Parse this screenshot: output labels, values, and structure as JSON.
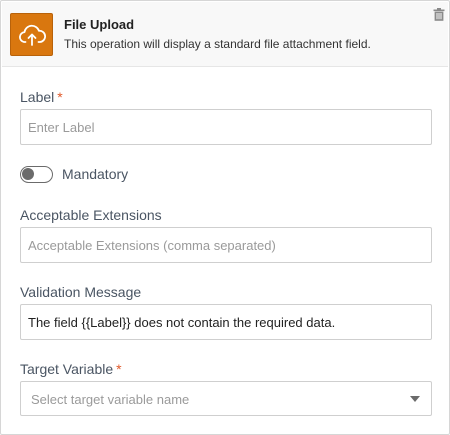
{
  "header": {
    "title": "File Upload",
    "description": "This operation will display a standard file attachment field.",
    "icon": "cloud-upload-icon",
    "icon_color": "#d9770f",
    "delete_icon": "trash-icon"
  },
  "form": {
    "label": {
      "label": "Label",
      "required": "*",
      "placeholder": "Enter Label",
      "value": ""
    },
    "mandatory": {
      "label": "Mandatory",
      "checked": false
    },
    "extensions": {
      "label": "Acceptable Extensions",
      "placeholder": "Acceptable Extensions (comma separated)",
      "value": ""
    },
    "validation": {
      "label": "Validation Message",
      "value": "The field {{Label}} does not contain the required data."
    },
    "target": {
      "label": "Target Variable",
      "required": "*",
      "placeholder": "Select target variable name"
    }
  },
  "colors": {
    "accent": "#d9770f",
    "required": "#e0592a",
    "label_text": "#4a5563"
  }
}
